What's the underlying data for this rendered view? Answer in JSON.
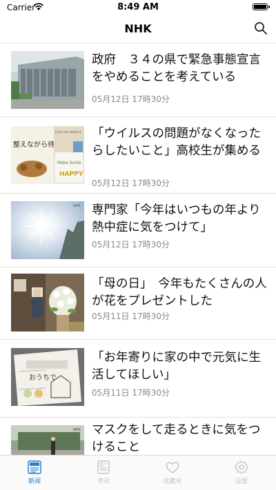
{
  "status_bar": {
    "carrier": "Carrier",
    "time": "8:49 AM"
  },
  "nav": {
    "title": "NHK",
    "search_icon": "search-icon"
  },
  "articles": [
    {
      "headline": "政府　３４の県で緊急事態宣言をやめることを考えている",
      "date": "05月12日 17時30分"
    },
    {
      "headline": "「ウイルスの問題がなくなったらしたいこと」高校生が集める",
      "date": "05月12日 17時30分"
    },
    {
      "headline": "専門家「今年はいつもの年より熱中症に気をつけて」",
      "date": "05月12日 17時30分"
    },
    {
      "headline": "「母の日」　今年もたくさんの人が花をプレゼントした",
      "date": "05月11日 17時30分"
    },
    {
      "headline": "「お年寄りに家の中で元気に生活してほしい」",
      "date": "05月11日 17時30分"
    },
    {
      "headline": "マスクをして走るときに気をつけること",
      "date": ""
    }
  ],
  "thumbnails": {
    "t2_text": "整えながら待つ時。",
    "t2_card": "HAPPY",
    "t2_card2": "Make Smile",
    "t2_corner": "If you can dream it",
    "t5_text": "おうちで",
    "nhk_mark": "NHK"
  },
  "tabs": [
    {
      "label": "新闻",
      "icon": "news-icon",
      "active": true
    },
    {
      "label": "资讯",
      "icon": "info-icon",
      "active": false
    },
    {
      "label": "收藏夹",
      "icon": "heart-icon",
      "active": false
    },
    {
      "label": "设置",
      "icon": "gear-icon",
      "active": false
    }
  ],
  "colors": {
    "accent": "#2a7fd4",
    "inactive": "#c6c6c6",
    "date": "#888888"
  }
}
